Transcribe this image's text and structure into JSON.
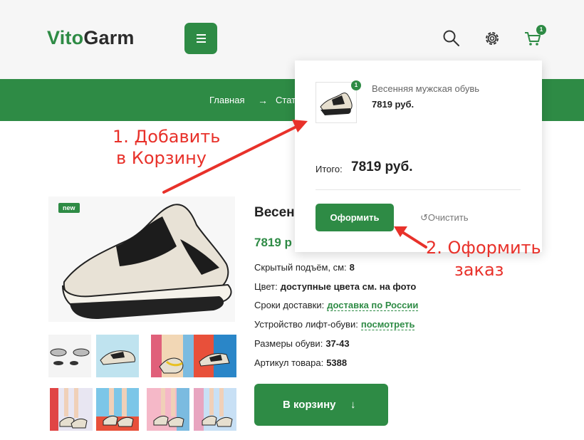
{
  "header": {
    "logo_part1": "Vito",
    "logo_part2": "Garm",
    "cart_count": "1"
  },
  "breadcrumb": {
    "home": "Главная",
    "current": "Стат"
  },
  "product": {
    "badge": "new",
    "title": "Весен",
    "price": "7819 р",
    "specs": [
      {
        "label": "Скрытый подъём, см:",
        "value": "8"
      },
      {
        "label": "Цвет:",
        "value": "доступные цвета см. на фото"
      },
      {
        "label": "Сроки доставки:",
        "value": "доставка по России"
      },
      {
        "label": "Устройство лифт-обуви:",
        "value": "посмотреть"
      },
      {
        "label": "Размеры обуви:",
        "value": "37-43"
      },
      {
        "label": "Артикул товара:",
        "value": "5388"
      }
    ],
    "add_to_cart": "В корзину",
    "add_to_cart_arrow": "↓"
  },
  "cart_dropdown": {
    "item_qty": "1",
    "item_name": "Весенняя мужская обувь",
    "item_price": "7819 руб.",
    "total_label": "Итого:",
    "total_value": "7819 руб.",
    "checkout_label": "Оформить",
    "clear_label": "Очистить",
    "clear_icon": "↺"
  },
  "annotations": {
    "step1_line1": "1. Добавить",
    "step1_line2": "в Корзину",
    "step2_line1": "2. Оформить",
    "step2_line2": "заказ"
  },
  "colors": {
    "brand_green": "#2e8b45",
    "annotation_red": "#e8312a"
  }
}
